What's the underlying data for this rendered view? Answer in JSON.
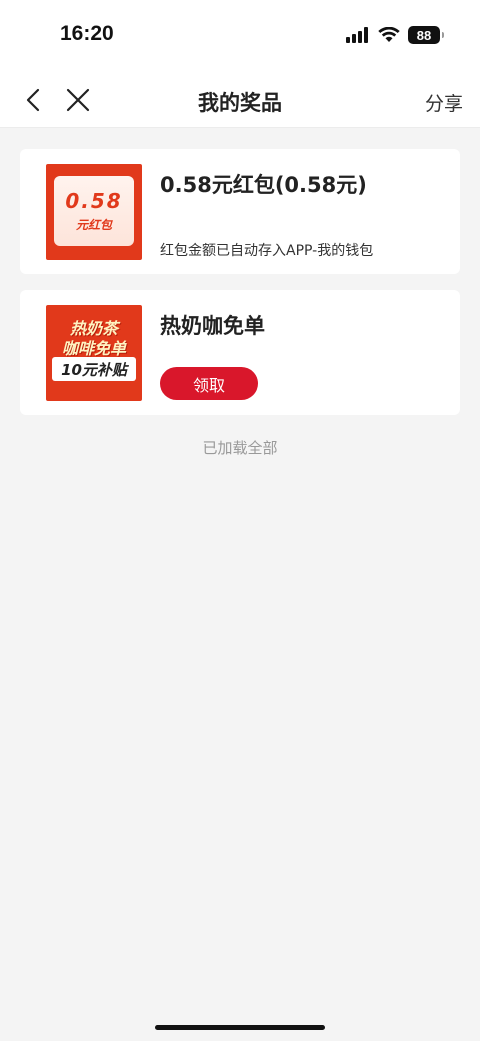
{
  "status_bar": {
    "time": "16:20",
    "battery": "88",
    "icons": [
      "signal-icon",
      "wifi-icon",
      "battery-icon"
    ]
  },
  "nav": {
    "title": "我的奖品",
    "share_label": "分享",
    "back_icon": "chevron-left-icon",
    "close_icon": "close-icon"
  },
  "prizes": [
    {
      "title": "0.58元红包(0.58元)",
      "description": "红包金额已自动存入APP-我的钱包",
      "thumb_amount": "0.58",
      "thumb_unit": "元红包"
    },
    {
      "title": "热奶咖免单",
      "button_label": "领取",
      "thumb_line1": "热奶茶",
      "thumb_line2": "咖啡免单",
      "thumb_line3": "10元补贴"
    }
  ],
  "footer": {
    "load_all": "已加载全部"
  },
  "colors": {
    "accent": "#d9172b",
    "thumb_red": "#e1391b",
    "background": "#f4f4f4"
  }
}
